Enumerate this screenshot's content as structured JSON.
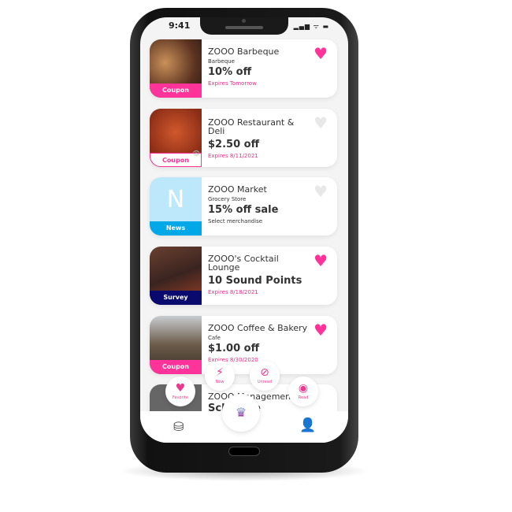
{
  "status_bar": {
    "time": "9:41",
    "indicators": "▂▄▆ ᯤ ▬"
  },
  "colors": {
    "pink": "#ff3399",
    "news": "#00a8e8",
    "survey": "#0a0a6e",
    "heart_off": "#e8e8e8"
  },
  "cards": [
    {
      "name": "ZOOO Barbeque",
      "category": "Barbeque",
      "deal": "10% off",
      "expires": "Expires Tomorrow",
      "tag": "Coupon",
      "favorite": true
    },
    {
      "name": "ZOOO Restaurant & Deli",
      "category": "",
      "deal": "$2.50 off",
      "expires": "Expires 8/11/2021",
      "tag": "Coupon",
      "favorite": false,
      "viewed": true
    },
    {
      "name": "ZOOO Market",
      "category": "Grocery Store",
      "deal": "15% off sale",
      "expires": "Select merchandise",
      "tag": "News",
      "letter": "N",
      "favorite": false
    },
    {
      "name": "ZOOO's Cocktail Lounge",
      "category": "",
      "deal": "10 Sound Points",
      "expires": "Expires 8/18/2021",
      "tag": "Survey",
      "favorite": true
    },
    {
      "name": "ZOOO Coffee & Bakery",
      "category": "Cafe",
      "deal": "$1.00 off",
      "expires": "Expires 8/30/2020",
      "tag": "Coupon",
      "favorite": true
    },
    {
      "name": "ZOOO Management",
      "category": "",
      "deal": "Schedule",
      "expires": "",
      "tag": "",
      "favorite": false
    }
  ],
  "filters": {
    "favorite": "Favorite",
    "new": "New",
    "unread": "Unread",
    "read": "Read"
  },
  "nav": {
    "wallet_icon": "coins-icon",
    "home_logo": "brand-logo",
    "profile_icon": "user-icon"
  }
}
